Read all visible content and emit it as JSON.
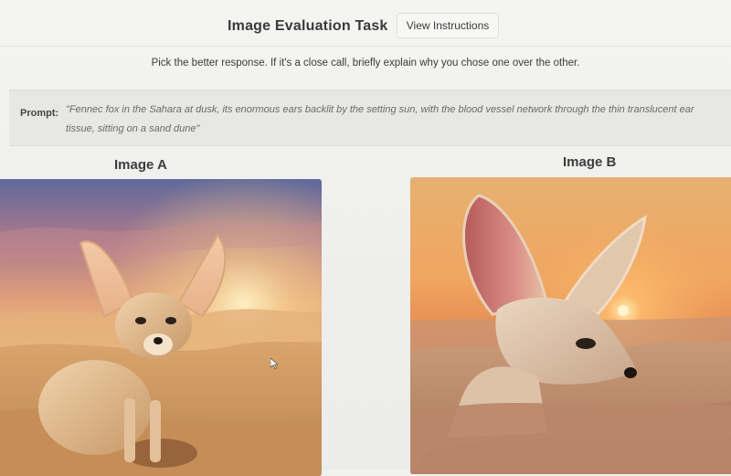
{
  "header": {
    "title": "Image Evaluation Task",
    "instructions_button": "View Instructions"
  },
  "instruction": "Pick the better response. If it's a close call, briefly explain why you chose one over the other.",
  "prompt": {
    "label": "Prompt:",
    "text": "\"Fennec fox in the Sahara at dusk, its enormous ears backlit by the setting sun, with the blood vessel network through the thin translucent ear tissue, sitting on a sand dune\""
  },
  "images": [
    {
      "label": "Image A"
    },
    {
      "label": "Image B"
    }
  ],
  "icons": {
    "cursor": "mouse-pointer-icon"
  },
  "colors": {
    "background": "#f1f1ef",
    "prompt_panel": "#e7e7e5",
    "title_text": "#3a3a3a",
    "prompt_text": "#6a6a68"
  }
}
